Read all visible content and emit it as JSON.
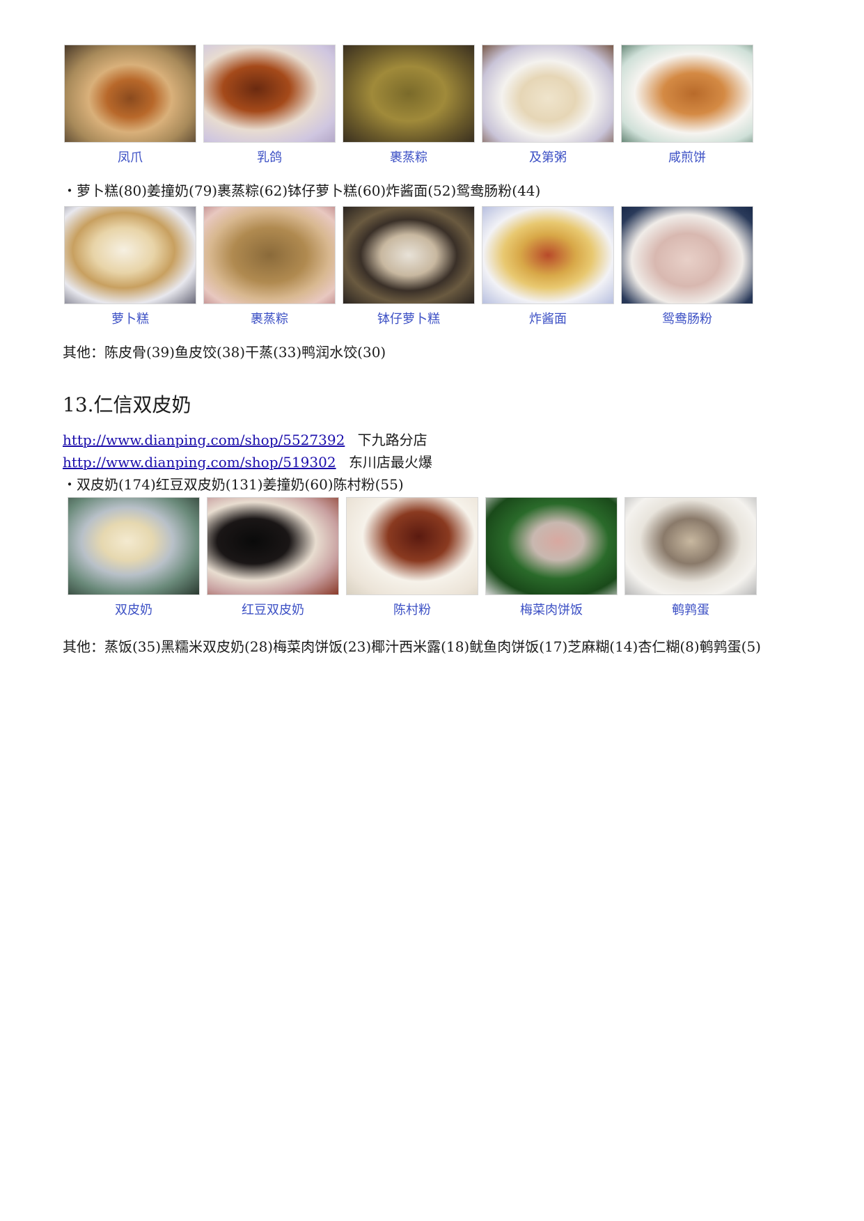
{
  "block1": {
    "captions": [
      "凤爪",
      "乳鸽",
      "裹蒸粽",
      "及第粥",
      "咸煎饼"
    ],
    "bullet": "萝卜糕(80)姜撞奶(79)裹蒸粽(62)钵仔萝卜糕(60)炸酱面(52)鸳鸯肠粉(44)"
  },
  "block2": {
    "captions": [
      "萝卜糕",
      "裹蒸粽",
      "钵仔萝卜糕",
      "炸酱面",
      "鸳鸯肠粉"
    ],
    "others": "其他：陈皮骨(39)鱼皮饺(38)干蒸(33)鸭润水饺(30)"
  },
  "section": {
    "title": "13.仁信双皮奶",
    "links": [
      {
        "url": "http://www.dianping.com/shop/5527392",
        "note": "下九路分店"
      },
      {
        "url": "http://www.dianping.com/shop/519302",
        "note": "东川店最火爆"
      }
    ],
    "bullet": "双皮奶(174)红豆双皮奶(131)姜撞奶(60)陈村粉(55)",
    "captions": [
      "双皮奶",
      "红豆双皮奶",
      "陈村粉",
      "梅菜肉饼饭",
      "鹌鹑蛋"
    ],
    "others": "其他：蒸饭(35)黑糯米双皮奶(28)梅菜肉饼饭(23)椰汁西米露(18)鱿鱼肉饼饭(17)芝麻糊(14)杏仁糊(8)鹌鹑蛋(5)"
  }
}
